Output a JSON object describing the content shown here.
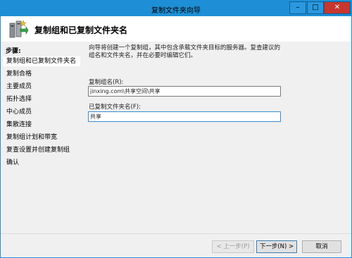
{
  "window": {
    "title": "复制文件夹向导",
    "controls": {
      "minimize": "–",
      "maximize": "□",
      "close": "✕"
    }
  },
  "header": {
    "title": "复制组和已复制文件夹名"
  },
  "steps": {
    "title": "步骤:",
    "items": [
      "复制组和已复制文件夹名",
      "复制合格",
      "主要成员",
      "拓扑选择",
      "中心成员",
      "集散连接",
      "复制组计划和带宽",
      "复查设置并创建复制组",
      "确认"
    ]
  },
  "main": {
    "description": "向导将创建一个复制组，其中包含承载文件夹目标的服务器。复查建议的组名和文件夹名，并在必要时编辑它们。",
    "group_name_label": "复制组名(R):",
    "group_name_value": "jinxing.com\\共享空间\\共享",
    "folder_name_label": "已复制文件夹名(F):",
    "folder_name_value": "共享"
  },
  "buttons": {
    "back": "< 上一步(P)",
    "next": "下一步(N) >",
    "cancel": "取消"
  },
  "icon": "replication-wizard-icon"
}
